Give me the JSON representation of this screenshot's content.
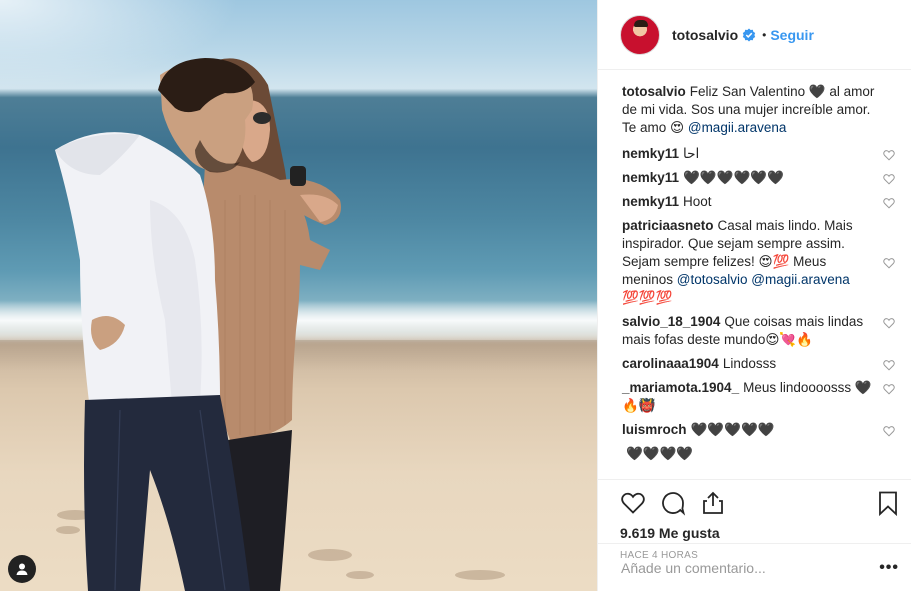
{
  "post": {
    "username": "totosalvio",
    "follow_label": "Seguir",
    "separator": "•",
    "caption": {
      "user": "totosalvio",
      "text": "Feliz San Valentino 🖤 al amor de mi vida. Sos una mujer increíble amor. Te amo 😍 ",
      "mention": "@magii.aravena"
    },
    "comments": [
      {
        "user": "nemky11",
        "text": "احا"
      },
      {
        "user": "nemky11",
        "text": "🖤🖤🖤🖤🖤🖤"
      },
      {
        "user": "nemky11",
        "text": "Hoot"
      },
      {
        "user": "patriciaasneto",
        "text": "Casal mais lindo. Mais inspirador. Que sejam sempre assim. Sejam sempre felizes! 😍💯 Meus meninos ",
        "mentions": "@totosalvio @magii.aravena",
        "tail": " 💯💯💯"
      },
      {
        "user": "salvio_18_1904",
        "text": "Que coisas mais lindas mais fofas deste mundo😍💘🔥"
      },
      {
        "user": "carolinaaa1904",
        "text": "Lindosss"
      },
      {
        "user": "_mariamota.1904_",
        "text": "Meus lindoooosss 🖤🔥👹"
      },
      {
        "user": "luismroch",
        "text": "🖤🖤🖤🖤🖤"
      },
      {
        "user": "",
        "text": "🖤🖤🖤🖤"
      }
    ],
    "likes": "9.619 Me gusta",
    "time": "HACE 4 HORAS",
    "add_comment_placeholder": "Añade un comentario...",
    "more_label": "•••"
  },
  "icons": {
    "verified": "verified-badge-icon",
    "like": "heart-icon",
    "comment": "comment-bubble-icon",
    "share": "share-icon",
    "save": "bookmark-icon",
    "profile": "user-profile-icon"
  },
  "colors": {
    "accent": "#3897f0",
    "mention": "#003569",
    "muted": "#999999",
    "text": "#262626"
  }
}
